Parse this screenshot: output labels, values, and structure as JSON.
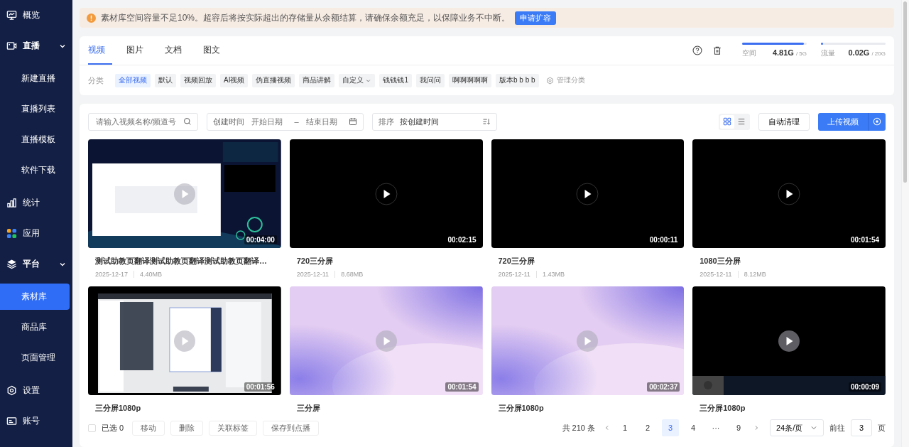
{
  "sidebar": {
    "items": [
      {
        "label": "概览"
      },
      {
        "label": "直播",
        "expanded": true,
        "children": [
          {
            "label": "新建直播",
            "selected": false
          },
          {
            "label": "直播列表",
            "selected": false
          },
          {
            "label": "直播模板",
            "selected": false
          },
          {
            "label": "软件下载",
            "selected": false
          }
        ]
      },
      {
        "label": "统计"
      },
      {
        "label": "应用"
      },
      {
        "label": "平台",
        "expanded": true,
        "children": [
          {
            "label": "素材库",
            "selected": true
          },
          {
            "label": "商品库",
            "selected": false
          },
          {
            "label": "页面管理",
            "selected": false
          }
        ]
      },
      {
        "label": "设置"
      },
      {
        "label": "账号"
      }
    ]
  },
  "notice": {
    "text": "素材库空间容量不足10%。超容后将按实际超出的存储量从余额结算，请确保余额充足，以保障业务不中断。",
    "button": "申请扩容"
  },
  "tabs": [
    {
      "label": "视频",
      "selected": true
    },
    {
      "label": "图片",
      "selected": false
    },
    {
      "label": "文档",
      "selected": false
    },
    {
      "label": "图文",
      "selected": false
    }
  ],
  "meters": [
    {
      "label": "空间",
      "level": 0.96,
      "value": "4.81G",
      "total": "/ 5G"
    },
    {
      "label": "流量",
      "level": 0.01,
      "value": "0.02G",
      "total": "/ 20G"
    }
  ],
  "categories": {
    "label": "分类",
    "items": [
      {
        "label": "全部视频",
        "kind": "chip",
        "selected": true
      },
      {
        "label": "默认",
        "kind": "chip",
        "selected": false
      },
      {
        "label": "视频回放",
        "kind": "chip",
        "selected": false
      },
      {
        "label": "AI视频",
        "kind": "chip",
        "selected": false
      },
      {
        "label": "伪直播视频",
        "kind": "chip",
        "selected": false
      },
      {
        "label": "商品讲解",
        "kind": "chip",
        "selected": false
      },
      {
        "label": "自定义",
        "kind": "dropdown",
        "selected": false
      },
      {
        "label": "钱钱钱1",
        "kind": "chip",
        "selected": false
      },
      {
        "label": "我问问",
        "kind": "chip",
        "selected": false
      },
      {
        "label": "啊啊啊啊啊",
        "kind": "chip",
        "selected": false
      },
      {
        "label": "版本b b b b",
        "kind": "chip",
        "selected": false
      }
    ],
    "manage": "管理分类"
  },
  "toolbar": {
    "search": {
      "placeholder": "请输入视频名称/频道号"
    },
    "date": {
      "label": "创建时间",
      "start_placeholder": "开始日期",
      "separator": "–",
      "end_placeholder": "结束日期"
    },
    "sort": {
      "label": "排序",
      "value": "按创建时间"
    },
    "views": [
      {
        "kind": "grid",
        "selected": true
      },
      {
        "kind": "list",
        "selected": false
      }
    ],
    "auto_clean": "自动清理",
    "upload": "上传视频"
  },
  "videos": [
    {
      "kind": "picture",
      "duration": "00:04:00",
      "title": "测试助教页翻译测试助教页翻译测试助教页翻译…",
      "date": "2025-12-17",
      "size": "4.40MB"
    },
    {
      "kind": "blank",
      "duration": "00:02:15",
      "title": "720三分屏",
      "date": "2025-12-11",
      "size": "8.68MB"
    },
    {
      "kind": "blank",
      "duration": "00:00:11",
      "title": "720三分屏",
      "date": "2025-12-11",
      "size": "1.43MB"
    },
    {
      "kind": "blank",
      "duration": "00:01:54",
      "title": "1080三分屏",
      "date": "2025-12-11",
      "size": "8.12MB"
    },
    {
      "kind": "picture",
      "duration": "00:01:56",
      "title": "三分屏1080p"
    },
    {
      "kind": "picture",
      "duration": "00:01:54",
      "title": "三分屏"
    },
    {
      "kind": "picture",
      "duration": "00:02:37",
      "title": "三分屏1080p"
    },
    {
      "kind": "picture",
      "duration": "00:00:09",
      "title": "三分屏1080p"
    }
  ],
  "footer": {
    "selected_count": "已选 0",
    "checked": false,
    "actions": [
      "移动",
      "删除",
      "关联标签",
      "保存到点播"
    ],
    "total": "共 210 条",
    "pages": [
      {
        "label": "1",
        "selected": false
      },
      {
        "label": "2",
        "selected": false
      },
      {
        "label": "3",
        "selected": true
      },
      {
        "label": "4",
        "selected": false
      },
      {
        "label": "···",
        "selected": false
      },
      {
        "label": "9",
        "selected": false
      }
    ],
    "page_size": "24条/页",
    "goto_label": "前往",
    "goto_value": "3",
    "goto_suffix": "页"
  }
}
